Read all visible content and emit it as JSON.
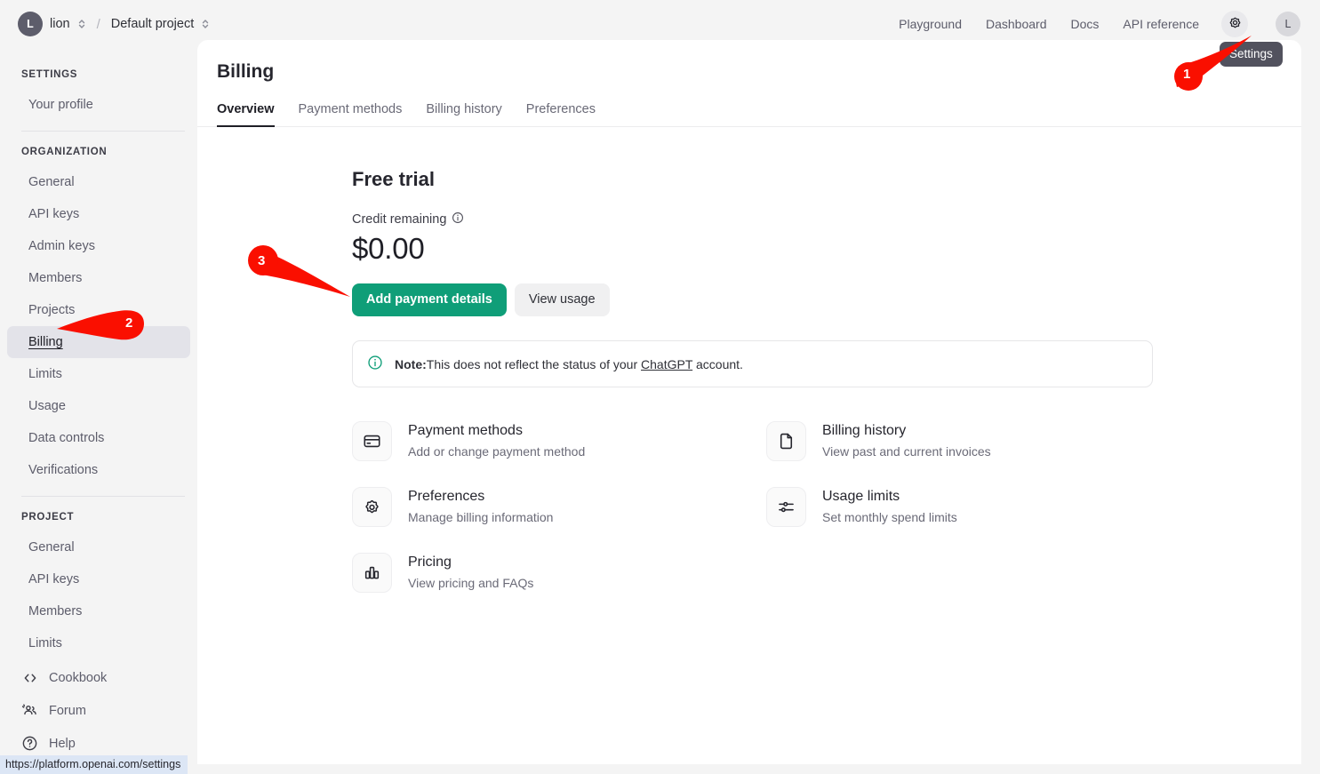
{
  "topbar": {
    "org_avatar_letter": "L",
    "org_name": "lion",
    "separator": "/",
    "project_name": "Default project",
    "nav": [
      {
        "label": "Playground"
      },
      {
        "label": "Dashboard"
      },
      {
        "label": "Docs"
      },
      {
        "label": "API reference"
      }
    ],
    "settings_icon": "gear-icon",
    "user_avatar_letter": "L",
    "tooltip": "Settings"
  },
  "sidebar": {
    "settings_header": "SETTINGS",
    "settings_items": [
      {
        "label": "Your profile",
        "selected": false
      }
    ],
    "organization_header": "ORGANIZATION",
    "organization_items": [
      {
        "label": "General",
        "selected": false
      },
      {
        "label": "API keys",
        "selected": false
      },
      {
        "label": "Admin keys",
        "selected": false
      },
      {
        "label": "Members",
        "selected": false
      },
      {
        "label": "Projects",
        "selected": false
      },
      {
        "label": "Billing",
        "selected": true
      },
      {
        "label": "Limits",
        "selected": false
      },
      {
        "label": "Usage",
        "selected": false
      },
      {
        "label": "Data controls",
        "selected": false
      },
      {
        "label": "Verifications",
        "selected": false
      }
    ],
    "project_header": "PROJECT",
    "project_items": [
      {
        "label": "General",
        "selected": false
      },
      {
        "label": "API keys",
        "selected": false
      },
      {
        "label": "Members",
        "selected": false
      },
      {
        "label": "Limits",
        "selected": false
      }
    ],
    "bottom_links": [
      {
        "label": "Cookbook",
        "icon": "code-icon"
      },
      {
        "label": "Forum",
        "icon": "people-icon"
      },
      {
        "label": "Help",
        "icon": "question-circle-icon"
      }
    ]
  },
  "main": {
    "title": "Billing",
    "tabs": [
      {
        "label": "Overview",
        "active": true
      },
      {
        "label": "Payment methods",
        "active": false
      },
      {
        "label": "Billing history",
        "active": false
      },
      {
        "label": "Preferences",
        "active": false
      }
    ],
    "plan_heading": "Free trial",
    "credit_label": "Credit remaining",
    "credit_info_icon": "info-circle-icon",
    "credit_amount": "$0.00",
    "primary_button": "Add payment details",
    "secondary_button": "View usage",
    "note": {
      "icon": "info-circle-icon",
      "prefix": "Note:",
      "text_before_link": "This does not reflect the status of your ",
      "link": "ChatGPT",
      "text_after_link": " account."
    },
    "tiles": [
      {
        "title": "Payment methods",
        "subtitle": "Add or change payment method",
        "icon": "credit-card-icon"
      },
      {
        "title": "Billing history",
        "subtitle": "View past and current invoices",
        "icon": "document-icon"
      },
      {
        "title": "Preferences",
        "subtitle": "Manage billing information",
        "icon": "gear-icon"
      },
      {
        "title": "Usage limits",
        "subtitle": "Set monthly spend limits",
        "icon": "sliders-icon"
      },
      {
        "title": "Pricing",
        "subtitle": "View pricing and FAQs",
        "icon": "bar-chart-icon"
      }
    ]
  },
  "annotations": {
    "color": "#fa0f00",
    "markers": [
      {
        "number": "1",
        "target": "settings-gear-icon"
      },
      {
        "number": "2",
        "target": "sidebar-item-billing"
      },
      {
        "number": "3",
        "target": "add-payment-details-button"
      }
    ]
  },
  "statusbar": {
    "url": "https://platform.openai.com/settings"
  }
}
